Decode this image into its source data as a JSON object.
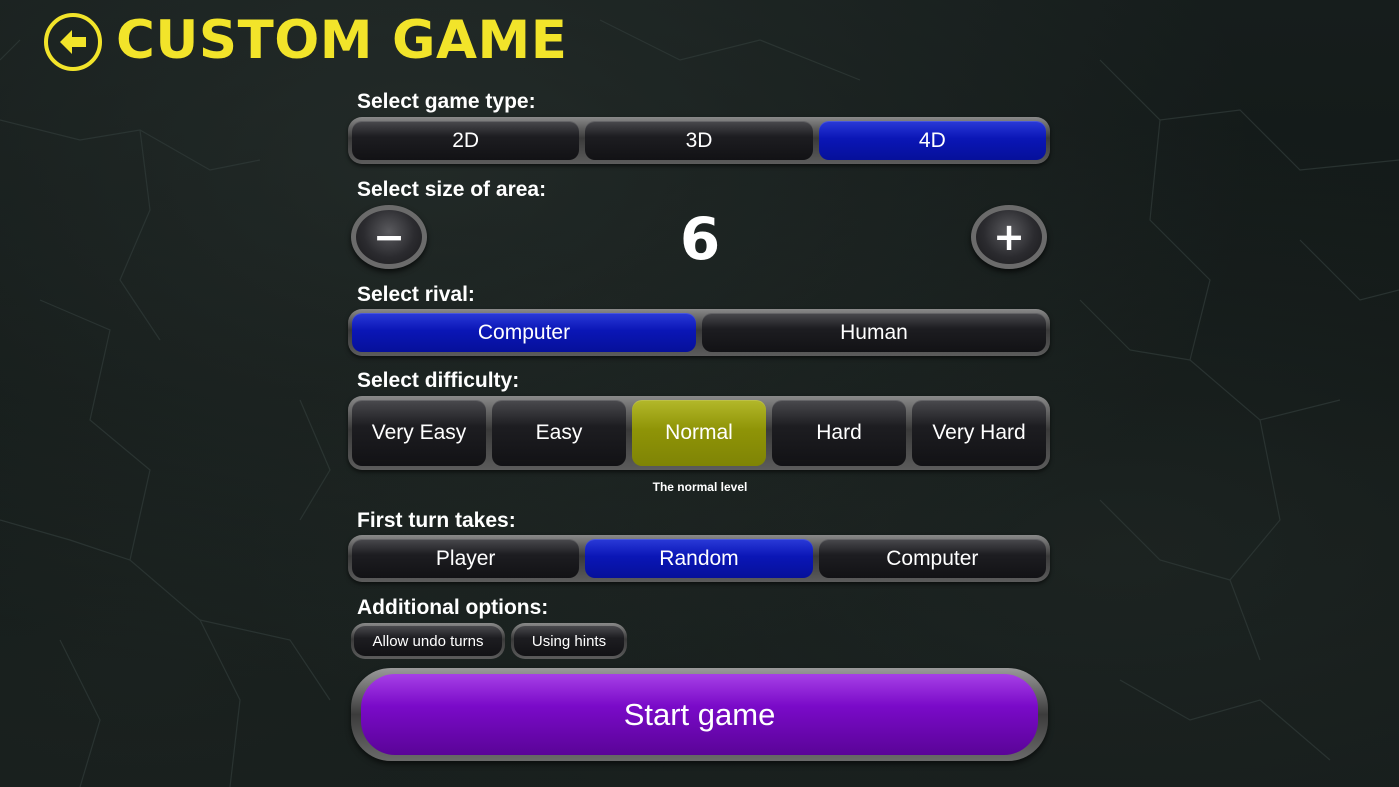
{
  "header": {
    "title": "CUSTOM GAME",
    "back_icon": "arrow-left-circle-icon"
  },
  "game_type": {
    "label": "Select game type:",
    "options": [
      "2D",
      "3D",
      "4D"
    ],
    "selected": "4D"
  },
  "area_size": {
    "label": "Select size of area:",
    "value": "6",
    "minus": "−",
    "plus": "+"
  },
  "rival": {
    "label": "Select rival:",
    "options": [
      "Computer",
      "Human"
    ],
    "selected": "Computer"
  },
  "difficulty": {
    "label": "Select difficulty:",
    "options": [
      "Very Easy",
      "Easy",
      "Normal",
      "Hard",
      "Very Hard"
    ],
    "selected": "Normal",
    "hint": "The normal level"
  },
  "first_turn": {
    "label": "First turn takes:",
    "options": [
      "Player",
      "Random",
      "Computer"
    ],
    "selected": "Random"
  },
  "additional": {
    "label": "Additional options:",
    "options": [
      "Allow undo turns",
      "Using hints"
    ]
  },
  "start": {
    "label": "Start game"
  },
  "colors": {
    "accent": "#f2e42a",
    "selected_blue": "#0a16b6",
    "selected_olive": "#8f9407",
    "start_purple": "#7a0ac8"
  }
}
